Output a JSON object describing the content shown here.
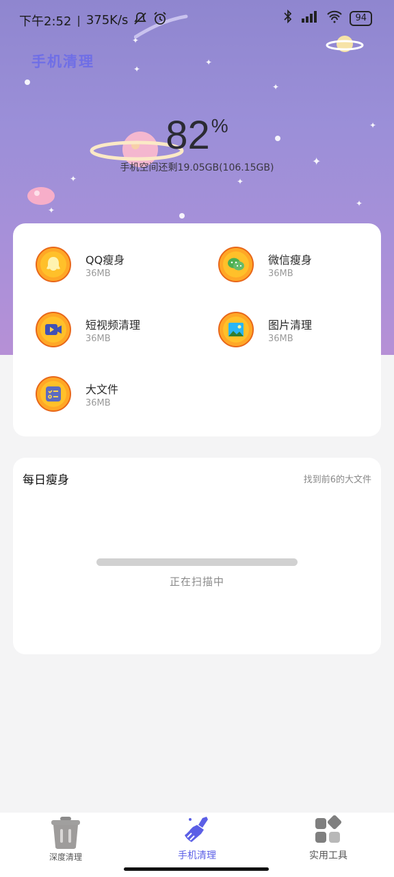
{
  "status_bar": {
    "time": "下午2:52",
    "speed": "375K/s",
    "battery": "94"
  },
  "header": {
    "app_title": "手机清理",
    "percent_value": "82",
    "percent_sign": "%",
    "storage_text": "手机空间还剩19.05GB(106.15GB)"
  },
  "tools": [
    {
      "name": "QQ瘦身",
      "size": "36MB",
      "icon": "qq-icon"
    },
    {
      "name": "微信瘦身",
      "size": "36MB",
      "icon": "wechat-icon"
    },
    {
      "name": "短视频清理",
      "size": "36MB",
      "icon": "video-icon"
    },
    {
      "name": "图片清理",
      "size": "36MB",
      "icon": "image-icon"
    },
    {
      "name": "大文件",
      "size": "36MB",
      "icon": "file-icon"
    }
  ],
  "daily": {
    "title": "每日瘦身",
    "hint": "找到前6的大文件",
    "progress": 0,
    "status": "正在扫描中"
  },
  "tabbar": {
    "tabs": [
      {
        "label": "深度清理",
        "icon": "trash-icon"
      },
      {
        "label": "手机清理",
        "icon": "broom-icon",
        "active": true
      },
      {
        "label": "实用工具",
        "icon": "grid-icon"
      }
    ]
  },
  "colors": {
    "accent": "#5b5fe6",
    "hero": "#9b8fd8",
    "badge_orange": "#ffa726"
  }
}
